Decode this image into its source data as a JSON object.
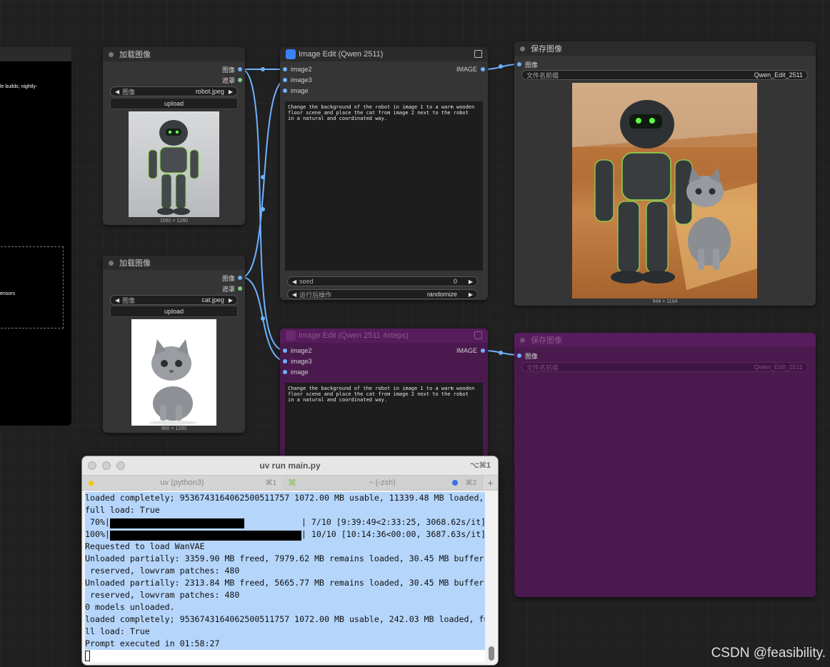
{
  "left_panel": {
    "line1": "le builds; nightly-",
    "line2": "ensors"
  },
  "load_node_1": {
    "title": "加载图像",
    "out_image": "图像",
    "out_mask": "遮罩",
    "image_label": "图像",
    "image_value": "robot.jpeg",
    "upload_label": "upload",
    "size": "1092 × 1280"
  },
  "load_node_2": {
    "title": "加载图像",
    "out_image": "图像",
    "out_mask": "遮罩",
    "image_label": "图像",
    "image_value": "cat.jpeg",
    "upload_label": "upload",
    "size": "960 × 1200"
  },
  "edit_node_1": {
    "title": "Image Edit (Qwen 2511)",
    "inputs": [
      "image2",
      "image3",
      "image"
    ],
    "output": "IMAGE",
    "prompt": "Change the background of the robot in image 1 to a warm wooden\nfloor scene and place the cat from image 2 next to the robot\nin a natural and coordinated way.",
    "seed_label": "seed",
    "seed_value": "0",
    "after_label": "运行后操作",
    "after_value": "randomize"
  },
  "edit_node_2": {
    "title": "Image Edit (Qwen 2511 4steps)",
    "inputs": [
      "image2",
      "image3",
      "image"
    ],
    "output": "IMAGE",
    "prompt": "Change the background of the robot in image 1 to a warm wooden\nfloor scene and place the cat from image 2 next to the robot\nin a natural and coordinated way."
  },
  "save_node_1": {
    "title": "保存图像",
    "input": "图像",
    "prefix_label": "文件名前缀",
    "prefix_value": "Qwen_Edit_2511",
    "size": "944 × 1104"
  },
  "save_node_2": {
    "title": "保存图像",
    "input": "图像",
    "prefix_label": "文件名前缀",
    "prefix_value": "Qwen_Edit_2511"
  },
  "terminal": {
    "title": "uv run main.py",
    "shortcut": "⌥⌘1",
    "tab1_label": "uv (python3)",
    "tab1_kbd": "⌘1",
    "tab2_label": "~ (-zsh)",
    "tab2_kbd": "⌘2",
    "lines": [
      "loaded completely; 9536743164062500511757 1072.00 MB usable, 11339.48 MB loaded,",
      "full load: True",
      "",
      "",
      "Requested to load WanVAE",
      "Unloaded partially: 3359.90 MB freed, 7979.62 MB remains loaded, 30.45 MB buffer",
      " reserved, lowvram patches: 480",
      "Unloaded partially: 2313.84 MB freed, 5665.77 MB remains loaded, 30.45 MB buffer",
      " reserved, lowvram patches: 480",
      "0 models unloaded.",
      "loaded completely; 9536743164062500511757 1072.00 MB usable, 242.03 MB loaded, fu",
      "ll load: True",
      "Prompt executed in 01:58:27"
    ],
    "progress1_prefix": " 70%|",
    "progress1_suffix": "| 7/10 [9:39:49<2:33:25, 3068.62s/it]",
    "progress1_fraction": 0.7,
    "progress2_prefix": "100%|",
    "progress2_suffix": "| 10/10 [10:14:36<00:00, 3687.63s/it]",
    "progress2_fraction": 1.0
  },
  "watermark": "CSDN @feasibility."
}
